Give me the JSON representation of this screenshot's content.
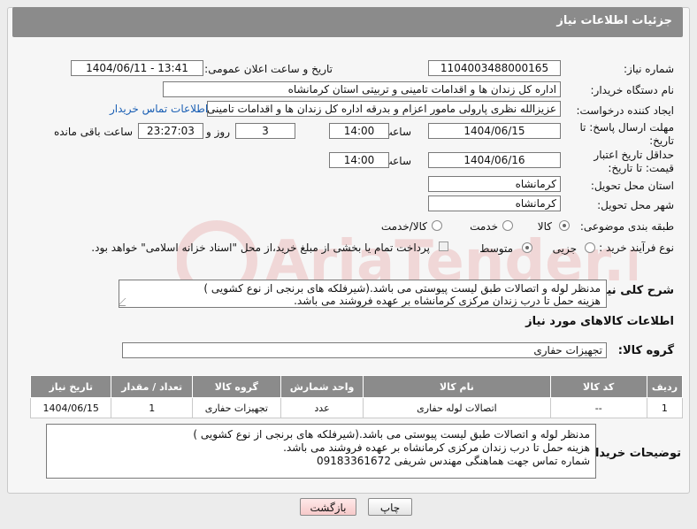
{
  "header": {
    "title": "جزئیات اطلاعات نیاز"
  },
  "fields": {
    "need_number_label": "شماره نیاز:",
    "need_number": "1104003488000165",
    "announce_label": "تاریخ و ساعت اعلان عمومی:",
    "announce_value": "1404/06/11 - 13:41",
    "buyer_org_label": "نام دستگاه خریدار:",
    "buyer_org": "اداره کل زندان ها و اقدامات تامینی و تربیتی استان کرمانشاه",
    "requester_label": "ایجاد کننده درخواست:",
    "requester": "عزیزالله نظری پارولی مامور اعزام و بدرقه اداره کل زندان ها و اقدامات تامینی و تربیتی",
    "contact_link": "اطلاعات تماس خریدار",
    "reply_deadline_label": "مهلت ارسال پاسخ: تا تاریخ:",
    "reply_date": "1404/06/15",
    "time_label": "ساعت",
    "reply_time": "14:00",
    "days_value": "3",
    "days_label": "روز و",
    "remaining_time": "23:27:03",
    "remaining_label": "ساعت باقی مانده",
    "price_deadline_label": "حداقل تاریخ اعتبار قیمت: تا تاریخ:",
    "price_date": "1404/06/16",
    "price_time": "14:00",
    "province_label": "استان محل تحویل:",
    "province": "کرمانشاه",
    "city_label": "شهر محل تحویل:",
    "city": "کرمانشاه",
    "category_label": "طبقه بندی موضوعی:",
    "category_options": [
      "کالا",
      "خدمت",
      "کالا/خدمت"
    ],
    "category_selected": "کالا",
    "process_label": "نوع فرآیند خرید :",
    "process_options": [
      "جزیی",
      "متوسط"
    ],
    "process_selected": "متوسط",
    "payment_note": "پرداخت تمام یا بخشی از مبلغ خرید،از محل \"اسناد خزانه اسلامی\" خواهد بود.",
    "description_label": "شرح کلی نیاز:",
    "description_lines": [
      "مدنظر لوله و اتصالات طبق لیست پیوستی می باشد.(شیرفلکه های برنجی از نوع کشویی )",
      "هزینه حمل تا درب زندان مرکزی کرمانشاه بر عهده فروشند می باشد."
    ]
  },
  "goods": {
    "section_title": "اطلاعات کالاهای مورد نیاز",
    "group_label": "گروه کالا:",
    "group_value": "تجهیزات حفاری",
    "columns": [
      "ردیف",
      "کد کالا",
      "نام کالا",
      "واحد شمارش",
      "گروه کالا",
      "تعداد / مقدار",
      "تاریخ نیاز"
    ],
    "rows": [
      [
        "1",
        "--",
        "اتصالات لوله حفاری",
        "عدد",
        "تجهیزات حفاری",
        "1",
        "1404/06/15"
      ]
    ]
  },
  "buyer_notes": {
    "label": "توضیحات خریدار:",
    "lines": [
      "مدنظر لوله و اتصالات طبق لیست پیوستی می باشد.(شیرفلکه های برنجی از نوع کشویی )",
      "هزینه حمل تا درب زندان مرکزی کرمانشاه بر عهده فروشند می باشد.",
      "شماره تماس جهت هماهنگی مهندس شریفی 09183361672"
    ]
  },
  "buttons": {
    "print": "چاپ",
    "back": "بازگشت"
  },
  "colors": {
    "header_bg": "#8b8b8b",
    "link": "#1a5fb4",
    "back_button": "#f6c9c9"
  },
  "watermark_text": "AriaTender.neT"
}
